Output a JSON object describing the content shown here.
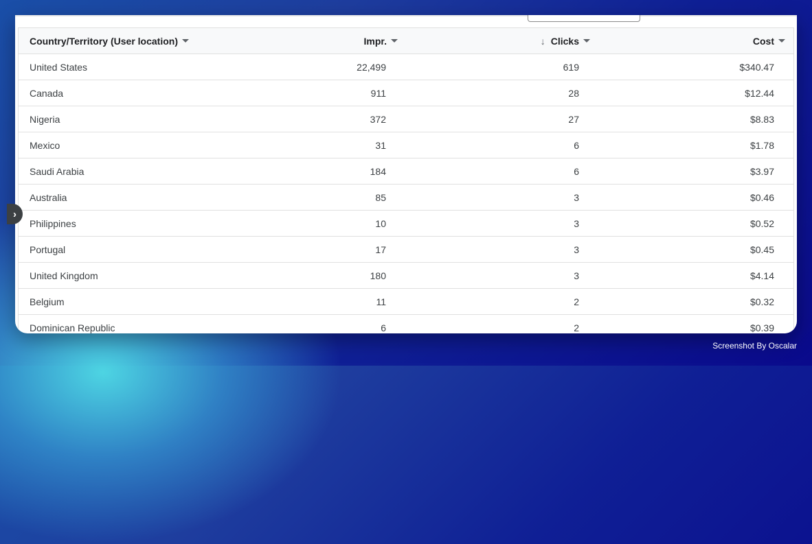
{
  "table": {
    "columns": [
      {
        "label": "Country/Territory (User location)"
      },
      {
        "label": "Impr."
      },
      {
        "label": "Clicks",
        "sorted": "descending"
      },
      {
        "label": "Cost"
      }
    ],
    "rows": [
      {
        "country": "United States",
        "impr": "22,499",
        "clicks": "619",
        "cost": "$340.47"
      },
      {
        "country": "Canada",
        "impr": "911",
        "clicks": "28",
        "cost": "$12.44"
      },
      {
        "country": "Nigeria",
        "impr": "372",
        "clicks": "27",
        "cost": "$8.83"
      },
      {
        "country": "Mexico",
        "impr": "31",
        "clicks": "6",
        "cost": "$1.78"
      },
      {
        "country": "Saudi Arabia",
        "impr": "184",
        "clicks": "6",
        "cost": "$3.97"
      },
      {
        "country": "Australia",
        "impr": "85",
        "clicks": "3",
        "cost": "$0.46"
      },
      {
        "country": "Philippines",
        "impr": "10",
        "clicks": "3",
        "cost": "$0.52"
      },
      {
        "country": "Portugal",
        "impr": "17",
        "clicks": "3",
        "cost": "$0.45"
      },
      {
        "country": "United Kingdom",
        "impr": "180",
        "clicks": "3",
        "cost": "$4.14"
      },
      {
        "country": "Belgium",
        "impr": "11",
        "clicks": "2",
        "cost": "$0.32"
      },
      {
        "country": "Dominican Republic",
        "impr": "6",
        "clicks": "2",
        "cost": "$0.39"
      }
    ]
  },
  "icons": {
    "sort": "arrow-down-icon",
    "dropdown": "caret-down-icon",
    "toggle": "chevron-right-icon"
  },
  "watermark": "Screenshot By Oscalar"
}
